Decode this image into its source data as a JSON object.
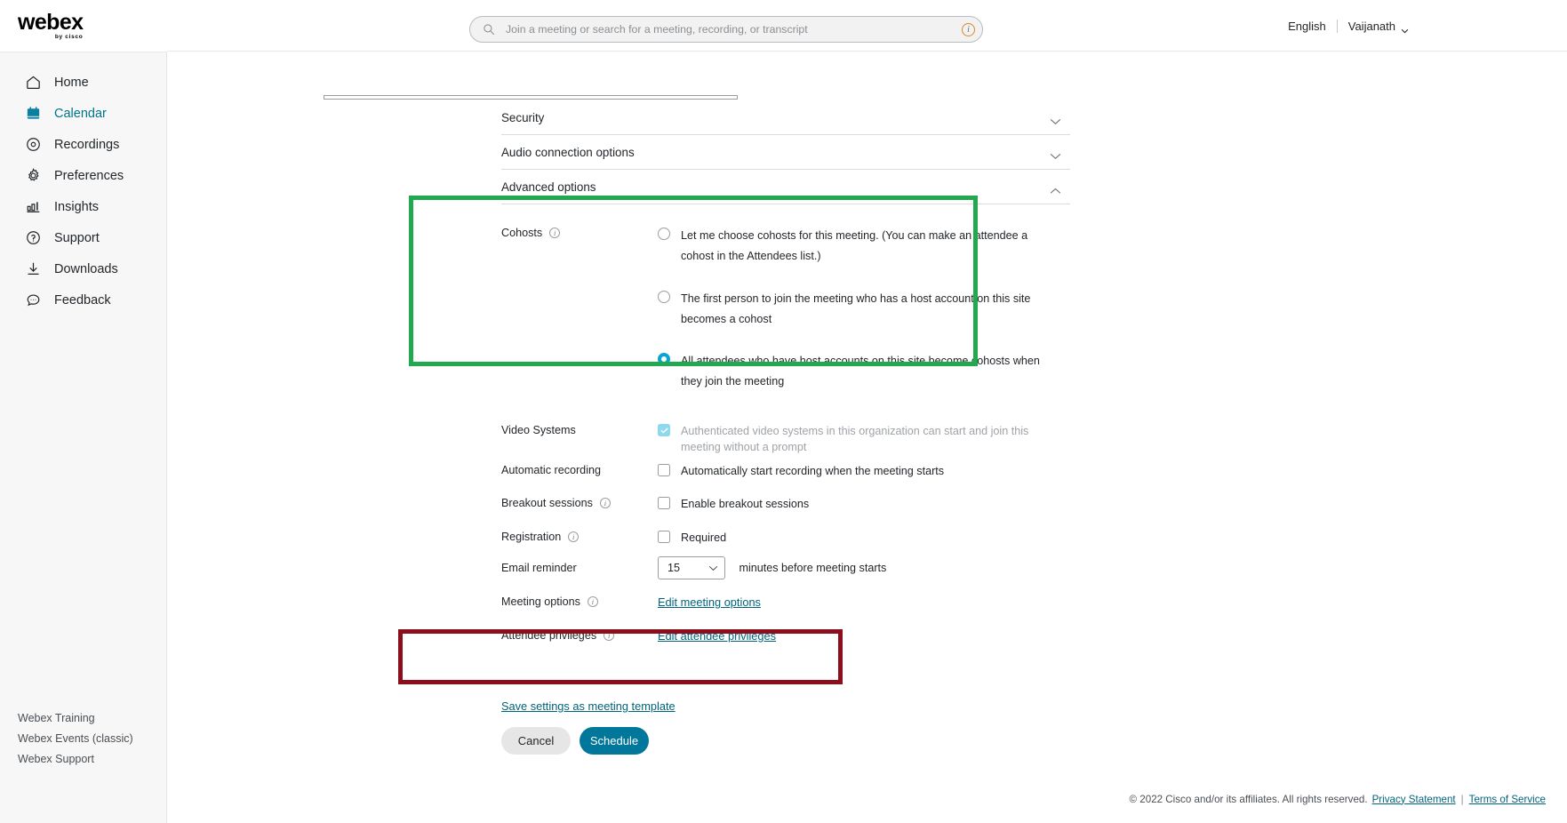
{
  "brand": {
    "name": "webex",
    "tagline": "by cisco"
  },
  "sidebar": {
    "items": [
      {
        "label": "Home",
        "icon": "home-icon",
        "active": false
      },
      {
        "label": "Calendar",
        "icon": "calendar-icon",
        "active": true
      },
      {
        "label": "Recordings",
        "icon": "recordings-icon",
        "active": false
      },
      {
        "label": "Preferences",
        "icon": "gear-icon",
        "active": false
      },
      {
        "label": "Insights",
        "icon": "chart-icon",
        "active": false
      },
      {
        "label": "Support",
        "icon": "question-icon",
        "active": false
      },
      {
        "label": "Downloads",
        "icon": "download-icon",
        "active": false
      },
      {
        "label": "Feedback",
        "icon": "feedback-icon",
        "active": false
      }
    ],
    "bottom_links": [
      {
        "label": "Webex Training"
      },
      {
        "label": "Webex Events (classic)"
      },
      {
        "label": "Webex Support"
      }
    ]
  },
  "header": {
    "search_placeholder": "Join a meeting or search for a meeting, recording, or transcript",
    "search_value": "",
    "language": "English",
    "user": "Vaijanath"
  },
  "accordions": [
    {
      "label": "Security",
      "expanded": false
    },
    {
      "label": "Audio connection options",
      "expanded": false
    },
    {
      "label": "Advanced options",
      "expanded": true
    }
  ],
  "advanced": {
    "cohosts": {
      "label": "Cohosts",
      "options": [
        {
          "text": "Let me choose cohosts for this meeting. (You can make an attendee a cohost in the Attendees list.)",
          "selected": false
        },
        {
          "text": "The first person to join the meeting who has a host account on this site becomes a cohost",
          "selected": false
        },
        {
          "text": "All attendees who have host accounts on this site become cohosts when they join the meeting",
          "selected": true
        }
      ]
    },
    "video_systems": {
      "label": "Video Systems",
      "option_text": "Authenticated video systems in this organization can start and join this meeting without a prompt",
      "checked": true,
      "disabled": true
    },
    "automatic_recording": {
      "label": "Automatic recording",
      "option_text": "Automatically start recording when the meeting starts",
      "checked": false
    },
    "breakout_sessions": {
      "label": "Breakout sessions",
      "option_text": "Enable breakout sessions",
      "checked": false
    },
    "registration": {
      "label": "Registration",
      "option_text": "Required",
      "checked": false
    },
    "email_reminder": {
      "label": "Email reminder",
      "value": "15",
      "suffix": "minutes before meeting starts"
    },
    "meeting_options": {
      "label": "Meeting options",
      "link": "Edit meeting options"
    },
    "attendee_privileges": {
      "label": "Attendee privileges",
      "link": "Edit attendee privileges"
    }
  },
  "actions": {
    "save_template_link": "Save settings as meeting template",
    "cancel": "Cancel",
    "schedule": "Schedule"
  },
  "footer": {
    "copyright": "© 2022 Cisco and/or its affiliates. All rights reserved.",
    "privacy": "Privacy Statement",
    "terms": "Terms of Service"
  },
  "highlights": {
    "green": "#22a84e",
    "red": "#8c0d1c"
  }
}
